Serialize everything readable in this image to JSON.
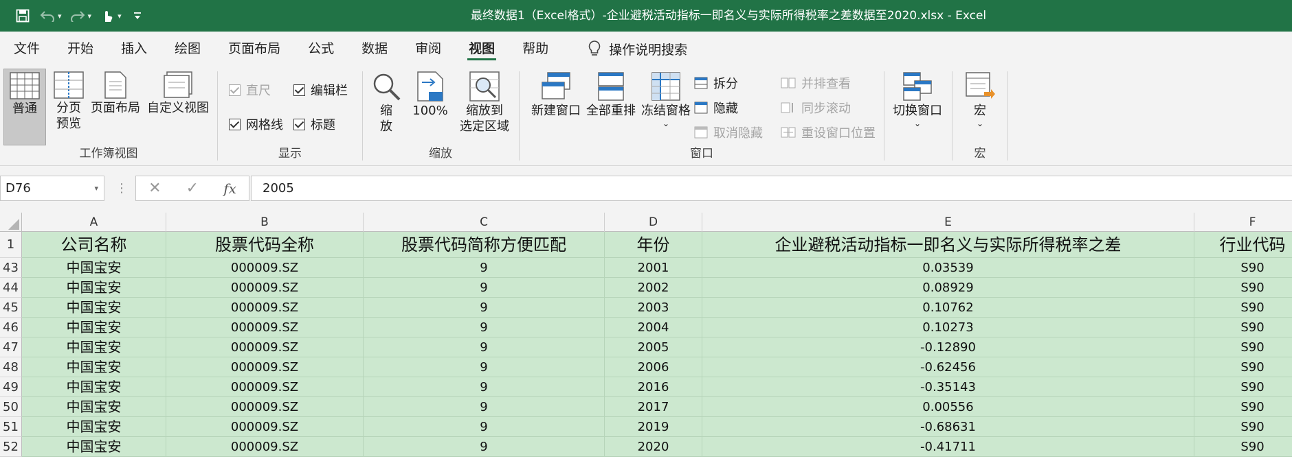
{
  "window": {
    "title": "最终数据1（Excel格式）-企业避税活动指标一即名义与实际所得税率之差数据至2020.xlsx  -  Excel"
  },
  "quick_access": {
    "icons": [
      "save-icon",
      "undo-icon",
      "redo-icon",
      "touch-mode-icon",
      "customize-icon"
    ]
  },
  "tabs": [
    "文件",
    "开始",
    "插入",
    "绘图",
    "页面布局",
    "公式",
    "数据",
    "审阅",
    "视图",
    "帮助"
  ],
  "active_tab": "视图",
  "tell_me": "操作说明搜索",
  "ribbon": {
    "workbook_views": {
      "label": "工作簿视图",
      "normal": "普通",
      "page_break_line1": "分页",
      "page_break_line2": "预览",
      "page_layout": "页面布局",
      "custom_views": "自定义视图"
    },
    "show": {
      "label": "显示",
      "ruler": "直尺",
      "formula_bar": "编辑栏",
      "gridlines": "网格线",
      "headings": "标题"
    },
    "zoom": {
      "label": "缩放",
      "zoom_line1": "缩",
      "zoom_line2": "放",
      "hundred": "100%",
      "hundred_badge": "100",
      "zoom_sel_line1": "缩放到",
      "zoom_sel_line2": "选定区域"
    },
    "window": {
      "label": "窗口",
      "new_window": "新建窗口",
      "arrange_all": "全部重排",
      "freeze_panes": "冻结窗格",
      "split": "拆分",
      "hide": "隐藏",
      "unhide": "取消隐藏",
      "side_by_side": "并排查看",
      "sync_scroll": "同步滚动",
      "reset_position": "重设窗口位置",
      "switch_windows": "切换窗口"
    },
    "macros": {
      "label": "宏",
      "macros": "宏"
    }
  },
  "formula_bar": {
    "name_box": "D76",
    "fx": "fx",
    "value": "2005"
  },
  "columns": [
    "A",
    "B",
    "C",
    "D",
    "E",
    "F"
  ],
  "header_row": {
    "num": "1",
    "cells": [
      "公司名称",
      "股票代码全称",
      "股票代码简称方便匹配",
      "年份",
      "企业避税活动指标一即名义与实际所得税率之差",
      "行业代码"
    ]
  },
  "rows": [
    {
      "num": "43",
      "cells": [
        "中国宝安",
        "000009.SZ",
        "9",
        "2001",
        "0.03539",
        "S90"
      ]
    },
    {
      "num": "44",
      "cells": [
        "中国宝安",
        "000009.SZ",
        "9",
        "2002",
        "0.08929",
        "S90"
      ]
    },
    {
      "num": "45",
      "cells": [
        "中国宝安",
        "000009.SZ",
        "9",
        "2003",
        "0.10762",
        "S90"
      ]
    },
    {
      "num": "46",
      "cells": [
        "中国宝安",
        "000009.SZ",
        "9",
        "2004",
        "0.10273",
        "S90"
      ]
    },
    {
      "num": "47",
      "cells": [
        "中国宝安",
        "000009.SZ",
        "9",
        "2005",
        "-0.12890",
        "S90"
      ]
    },
    {
      "num": "48",
      "cells": [
        "中国宝安",
        "000009.SZ",
        "9",
        "2006",
        "-0.62456",
        "S90"
      ]
    },
    {
      "num": "49",
      "cells": [
        "中国宝安",
        "000009.SZ",
        "9",
        "2016",
        "-0.35143",
        "S90"
      ]
    },
    {
      "num": "50",
      "cells": [
        "中国宝安",
        "000009.SZ",
        "9",
        "2017",
        "0.00556",
        "S90"
      ]
    },
    {
      "num": "51",
      "cells": [
        "中国宝安",
        "000009.SZ",
        "9",
        "2019",
        "-0.68631",
        "S90"
      ]
    },
    {
      "num": "52",
      "cells": [
        "中国宝安",
        "000009.SZ",
        "9",
        "2020",
        "-0.41711",
        "S90"
      ]
    }
  ],
  "colors": {
    "brand": "#217346",
    "cell_fill": "#cce8cf"
  }
}
